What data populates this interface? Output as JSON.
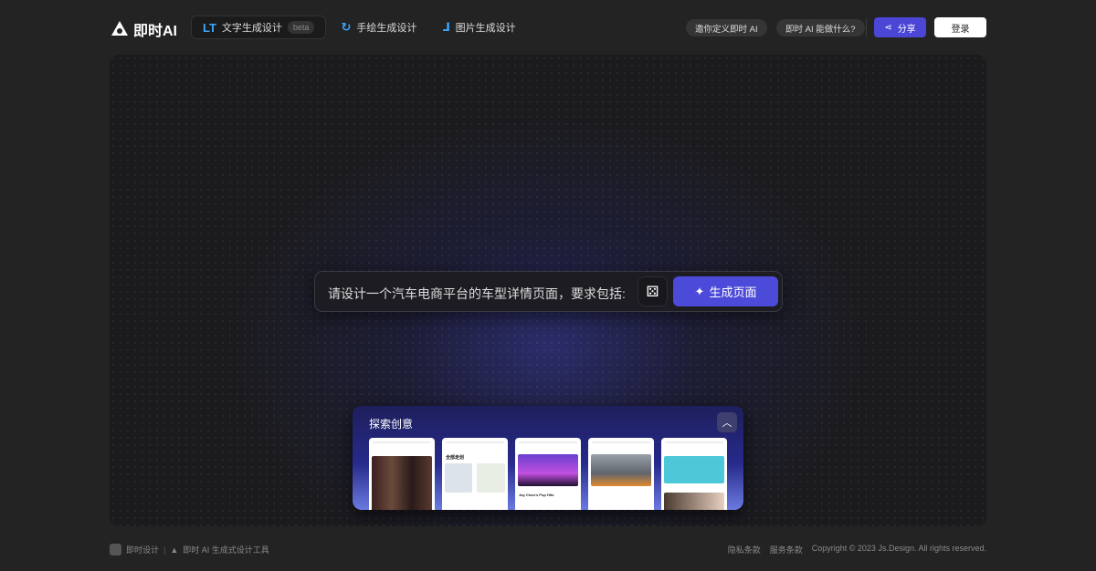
{
  "header": {
    "brand": "即时AI",
    "tabs": [
      {
        "label": "文字生成设计",
        "badge": "beta",
        "icon": "text-icon"
      },
      {
        "label": "手绘生成设计",
        "icon": "sketch-icon"
      },
      {
        "label": "图片生成设计",
        "icon": "image-icon"
      }
    ],
    "invite": "邀你定义即时 AI",
    "about": "即时 AI 能做什么?",
    "share": "分享",
    "login": "登录"
  },
  "prompt": {
    "value": "请设计一个汽车电商平台的车型详情页面，要求包括:",
    "random_icon": "dice-icon",
    "generate": "生成页面"
  },
  "explore": {
    "title": "探索创意",
    "cards": [
      {
        "title": ""
      },
      {
        "title": "全部走划"
      },
      {
        "title": "Jay Chou's Pop Hits"
      },
      {
        "title": ""
      },
      {
        "title": ""
      }
    ]
  },
  "footer": {
    "left1": "即时设计",
    "left2": "即时 AI 生成式设计工具",
    "privacy": "隐私条款",
    "terms": "服务条款",
    "copyright": "Copyright © 2023 Js.Design. All rights reserved."
  }
}
